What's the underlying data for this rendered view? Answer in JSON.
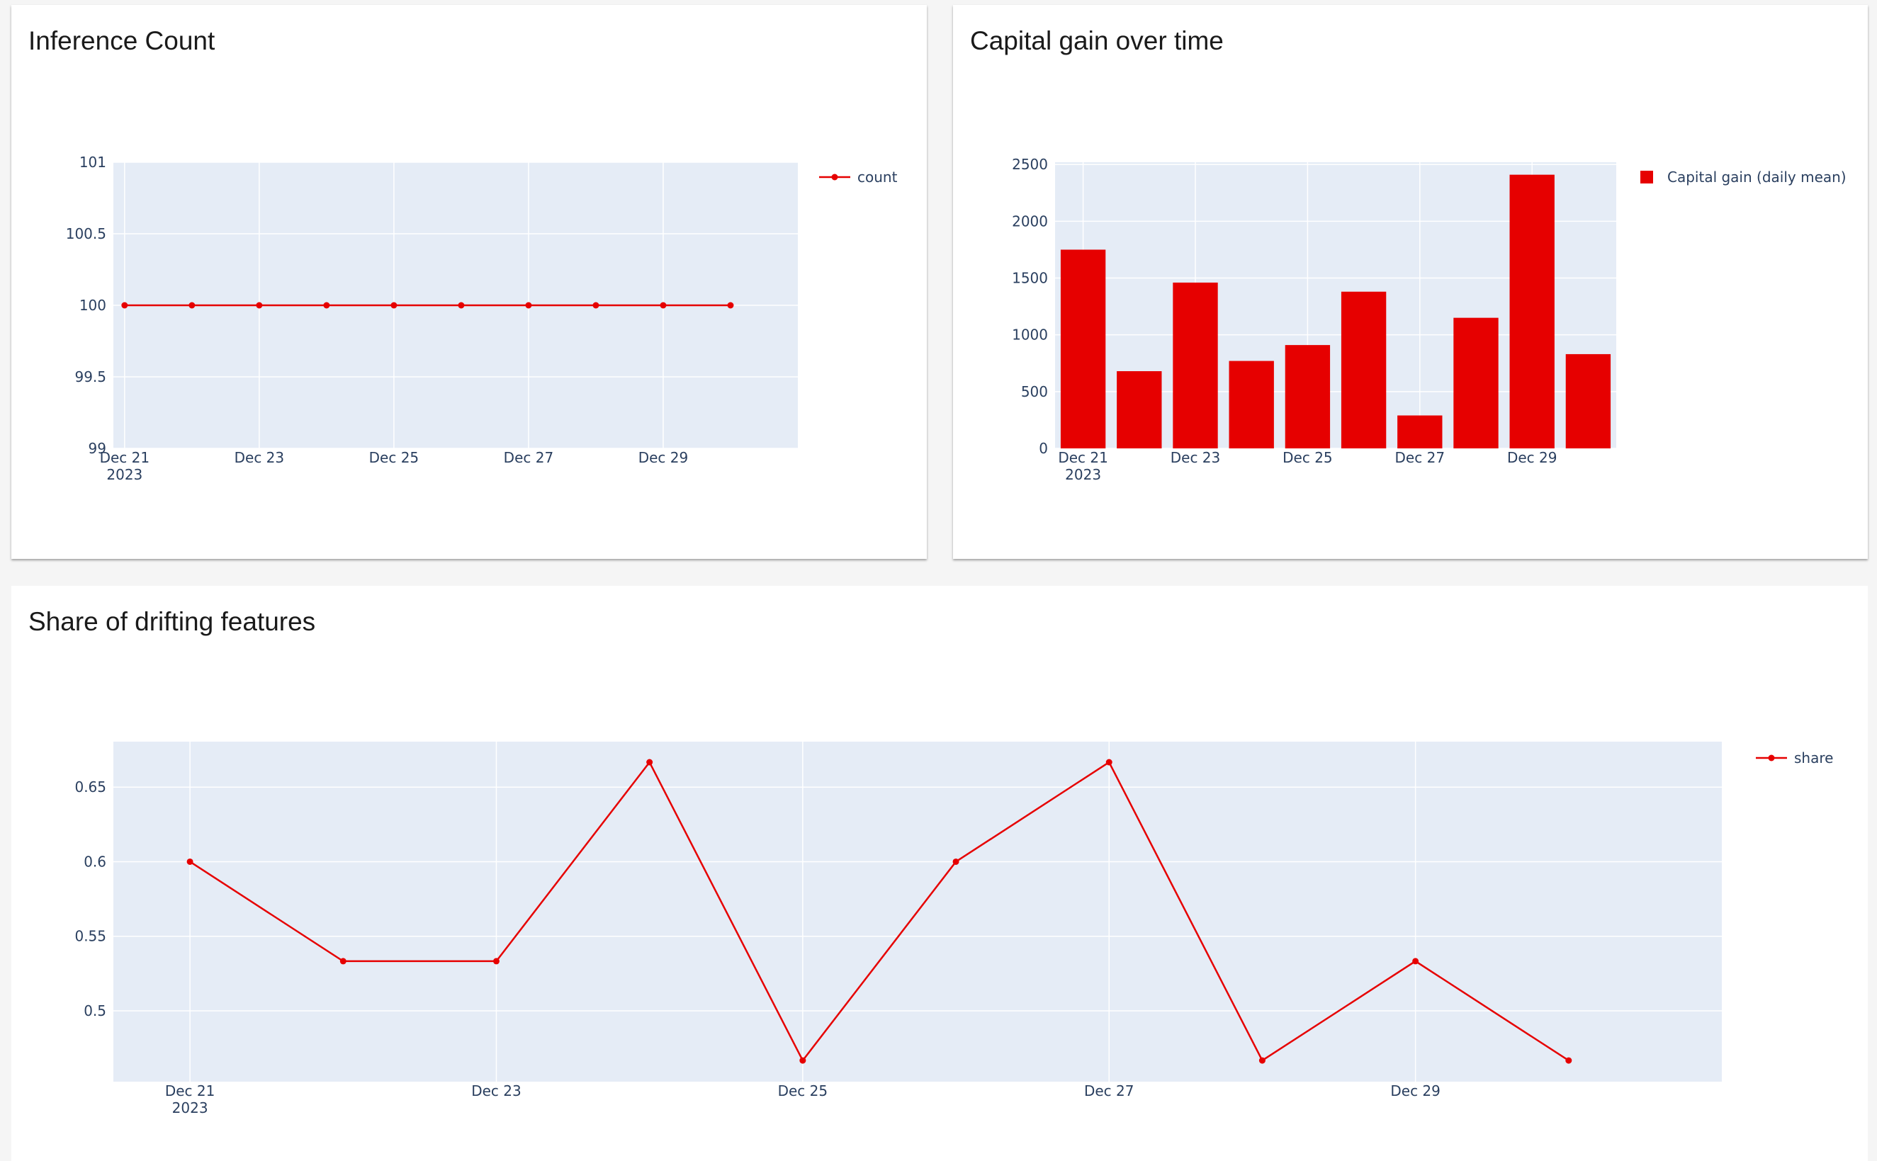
{
  "colors": {
    "accent": "#e60000",
    "plot_bg": "#e5ecf6",
    "grid": "#ffffff",
    "tick_text": "#2a3f5f"
  },
  "panels": {
    "inference": {
      "title": "Inference Count"
    },
    "capital": {
      "title": "Capital gain over time"
    },
    "drift": {
      "title": "Share of drifting features"
    }
  },
  "chart_data": [
    {
      "id": "inference",
      "type": "line",
      "title": "Inference Count",
      "x": [
        "2023-12-21",
        "2023-12-22",
        "2023-12-23",
        "2023-12-24",
        "2023-12-25",
        "2023-12-26",
        "2023-12-27",
        "2023-12-28",
        "2023-12-29",
        "2023-12-30"
      ],
      "series": [
        {
          "name": "count",
          "values": [
            100,
            100,
            100,
            100,
            100,
            100,
            100,
            100,
            100,
            100
          ]
        }
      ],
      "xlim": [
        "2023-12-20T20:00",
        "2023-12-31T00:00"
      ],
      "ylim": [
        99,
        101
      ],
      "yticks": [
        99,
        99.5,
        100,
        100.5,
        101
      ],
      "ytick_labels": [
        "99",
        "99.5",
        "100",
        "100.5",
        "101"
      ],
      "xticks": [
        "2023-12-21",
        "2023-12-23",
        "2023-12-25",
        "2023-12-27",
        "2023-12-29"
      ],
      "xtick_labels": [
        [
          "Dec 21",
          "2023"
        ],
        [
          "Dec 23"
        ],
        [
          "Dec 25"
        ],
        [
          "Dec 27"
        ],
        [
          "Dec 29"
        ]
      ],
      "grid": true,
      "legend": "top-right"
    },
    {
      "id": "capital",
      "type": "bar",
      "title": "Capital gain over time",
      "x": [
        "2023-12-21",
        "2023-12-22",
        "2023-12-23",
        "2023-12-24",
        "2023-12-25",
        "2023-12-26",
        "2023-12-27",
        "2023-12-28",
        "2023-12-29",
        "2023-12-30"
      ],
      "series": [
        {
          "name": "Capital gain (daily mean)",
          "values": [
            1750,
            680,
            1460,
            770,
            910,
            1380,
            290,
            1150,
            2410,
            830
          ]
        }
      ],
      "xlim": [
        "2023-12-20T12:00",
        "2023-12-30T12:00"
      ],
      "ylim": [
        0,
        2520
      ],
      "yticks": [
        0,
        500,
        1000,
        1500,
        2000,
        2500
      ],
      "ytick_labels": [
        "0",
        "500",
        "1000",
        "1500",
        "2000",
        "2500"
      ],
      "xticks": [
        "2023-12-21",
        "2023-12-23",
        "2023-12-25",
        "2023-12-27",
        "2023-12-29"
      ],
      "xtick_labels": [
        [
          "Dec 21",
          "2023"
        ],
        [
          "Dec 23"
        ],
        [
          "Dec 25"
        ],
        [
          "Dec 27"
        ],
        [
          "Dec 29"
        ]
      ],
      "grid": true,
      "legend": "top-right"
    },
    {
      "id": "drift",
      "type": "line",
      "title": "Share of drifting features",
      "x": [
        "2023-12-21",
        "2023-12-22",
        "2023-12-23",
        "2023-12-24",
        "2023-12-25",
        "2023-12-26",
        "2023-12-27",
        "2023-12-28",
        "2023-12-29",
        "2023-12-30"
      ],
      "series": [
        {
          "name": "share",
          "values": [
            0.6,
            0.5333,
            0.5333,
            0.6667,
            0.4667,
            0.6,
            0.6667,
            0.4667,
            0.5333,
            0.4667
          ]
        }
      ],
      "xlim": [
        "2023-12-20T12:00",
        "2023-12-31T00:00"
      ],
      "ylim": [
        0.4525,
        0.6805
      ],
      "yticks": [
        0.5,
        0.55,
        0.6,
        0.65
      ],
      "ytick_labels": [
        "0.5",
        "0.55",
        "0.6",
        "0.65"
      ],
      "xticks": [
        "2023-12-21",
        "2023-12-23",
        "2023-12-25",
        "2023-12-27",
        "2023-12-29"
      ],
      "xtick_labels": [
        [
          "Dec 21",
          "2023"
        ],
        [
          "Dec 23"
        ],
        [
          "Dec 25"
        ],
        [
          "Dec 27"
        ],
        [
          "Dec 29"
        ]
      ],
      "grid": true,
      "legend": "top-right"
    }
  ]
}
